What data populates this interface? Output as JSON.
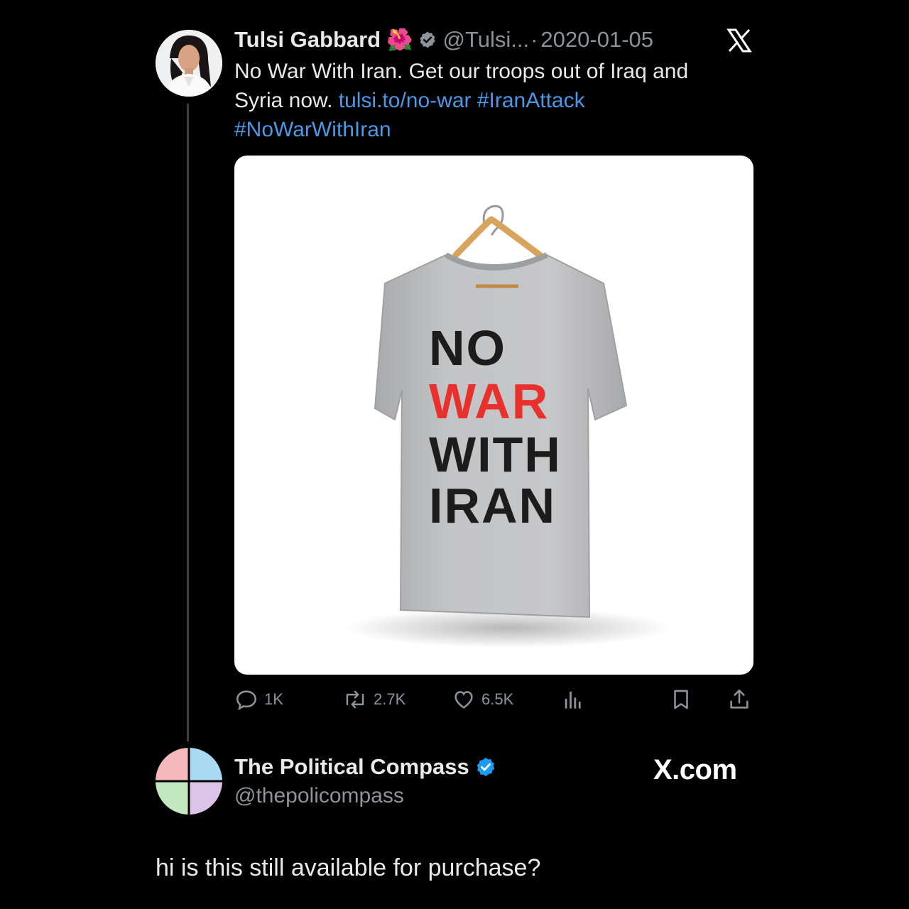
{
  "tweet": {
    "author_name": "Tulsi Gabbard",
    "author_emoji": "🌺",
    "handle": "@Tulsi...",
    "separator": "·",
    "date": "2020-01-05",
    "text_plain": "No War With Iran. Get our troops out of Iraq and Syria now.",
    "link": "tulsi.to/no-war",
    "hashtag_1": "#IranAttack",
    "hashtag_2": "#NoWarWithIran",
    "shirt_lines": [
      "NO",
      "WAR",
      "WITH",
      "IRAN"
    ],
    "actions": {
      "replies": "1K",
      "reposts": "2.7K",
      "likes": "6.5K"
    }
  },
  "reply": {
    "author_name": "The Political Compass",
    "handle": "@thepolicompass",
    "watermark": "X.com",
    "text": "hi is this still available for purchase?"
  },
  "colors": {
    "background": "#000000",
    "link": "#4a99e9",
    "verified": "#1d9bf0",
    "muted": "#8b949b",
    "shirt_red": "#e8312c"
  },
  "icons": [
    "x-logo-icon",
    "verified-badge-icon",
    "reply-icon",
    "repost-icon",
    "like-icon",
    "views-icon",
    "bookmark-icon",
    "share-icon"
  ]
}
